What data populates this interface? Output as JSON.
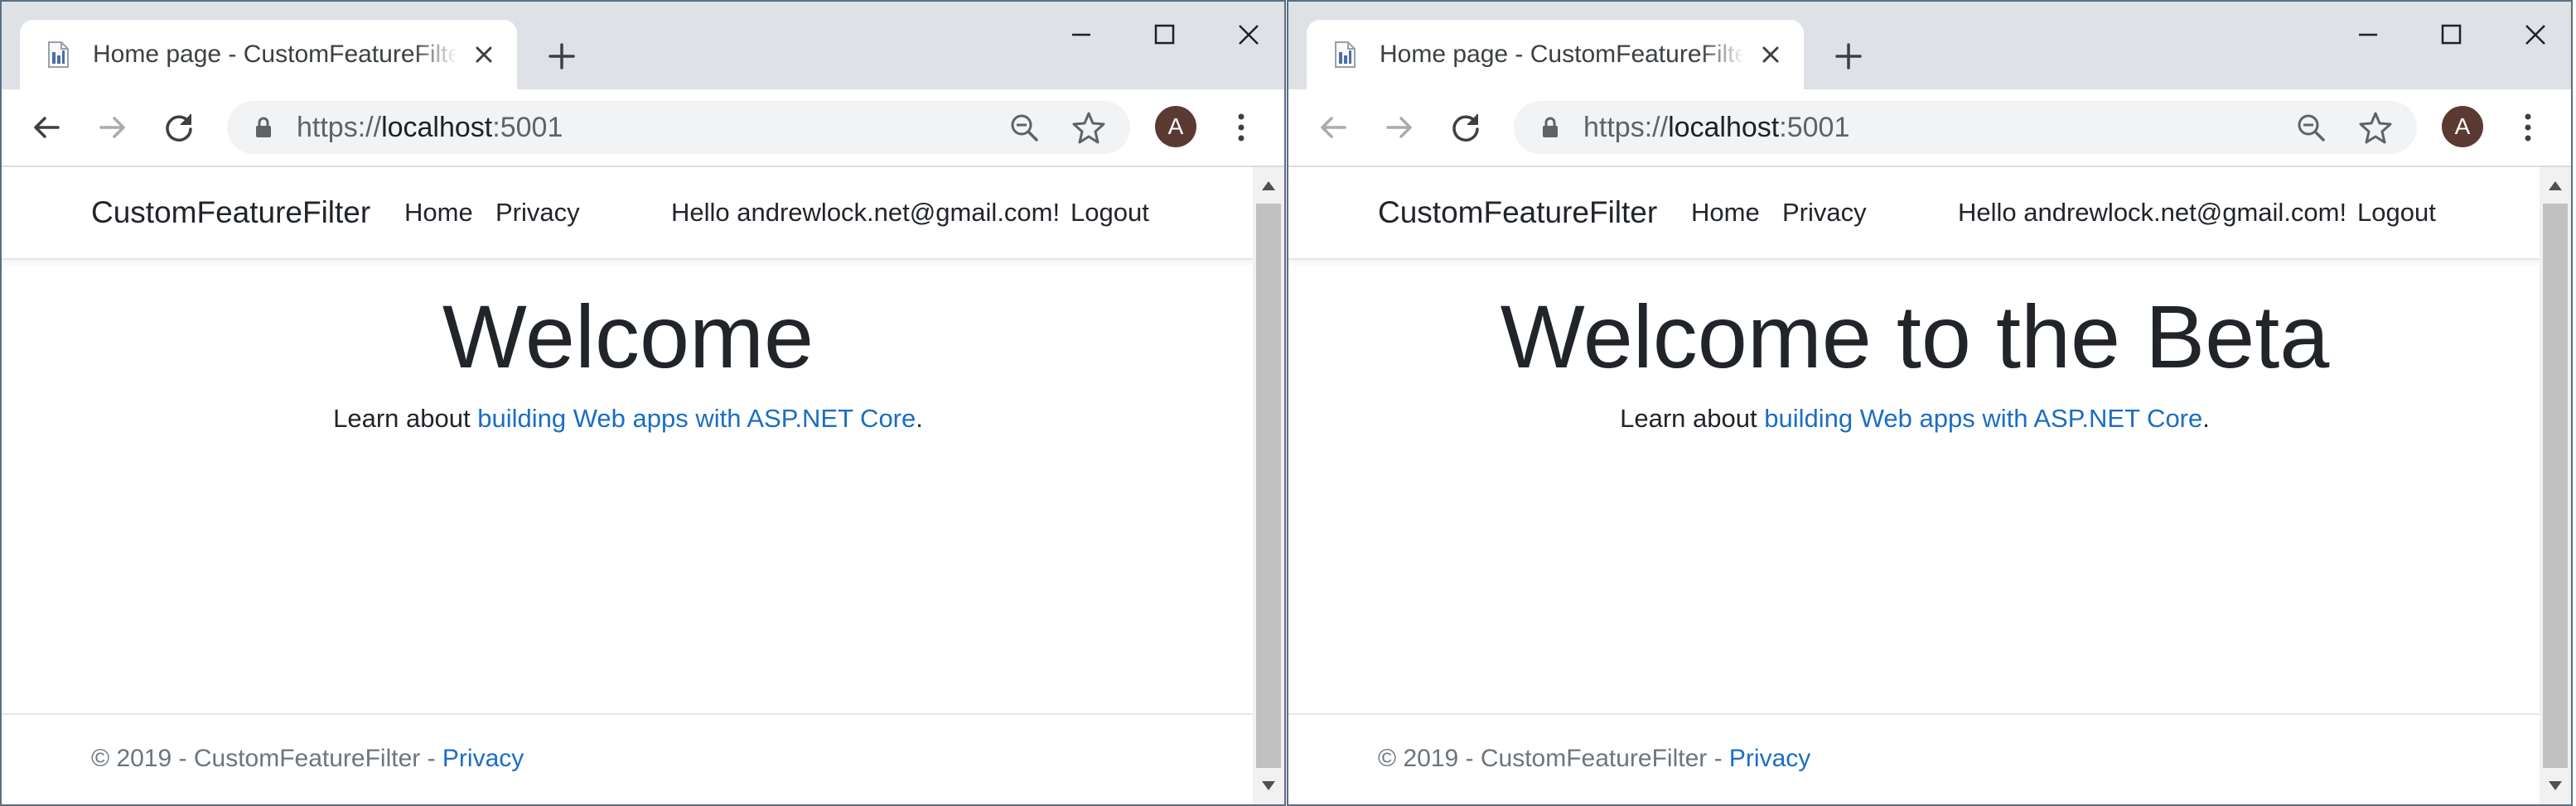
{
  "windows": [
    {
      "tab": {
        "title": "Home page - CustomFeatureFilter"
      },
      "url": {
        "scheme": "https://",
        "host": "localhost",
        "port": ":5001"
      },
      "profile_initial": "A",
      "site": {
        "brand": "CustomFeatureFilter",
        "nav": {
          "home": "Home",
          "privacy": "Privacy"
        },
        "hello": "Hello andrewlock.net@gmail.com!",
        "logout": "Logout",
        "heading": "Welcome",
        "lead_prefix": "Learn about ",
        "lead_link": "building Web apps with ASP.NET Core",
        "lead_suffix": ".",
        "footer_text": "© 2019 - CustomFeatureFilter - ",
        "footer_link": "Privacy"
      }
    },
    {
      "tab": {
        "title": "Home page - CustomFeatureFilter"
      },
      "url": {
        "scheme": "https://",
        "host": "localhost",
        "port": ":5001"
      },
      "profile_initial": "A",
      "site": {
        "brand": "CustomFeatureFilter",
        "nav": {
          "home": "Home",
          "privacy": "Privacy"
        },
        "hello": "Hello andrewlock.net@gmail.com!",
        "logout": "Logout",
        "heading": "Welcome to the Beta",
        "lead_prefix": "Learn about ",
        "lead_link": "building Web apps with ASP.NET Core",
        "lead_suffix": ".",
        "footer_text": "© 2019 - CustomFeatureFilter - ",
        "footer_link": "Privacy"
      }
    }
  ],
  "colors": {
    "link": "#1b6ec2",
    "text": "#212529",
    "muted": "#6c757d",
    "tabstrip": "#dee1e6",
    "omnibox": "#f1f3f4",
    "avatar": "#5b3a33",
    "window_border": "#5b6e82"
  },
  "icons": {
    "favicon": "page-favicon-icon",
    "tab_close": "close-icon",
    "new_tab": "plus-icon",
    "minimize": "minimize-icon",
    "maximize": "maximize-icon",
    "close": "close-icon",
    "back": "arrow-left-icon",
    "forward": "arrow-right-icon",
    "reload": "reload-icon",
    "lock": "lock-icon",
    "zoom": "zoom-out-icon",
    "bookmark": "star-icon",
    "menu": "kebab-menu-icon"
  }
}
